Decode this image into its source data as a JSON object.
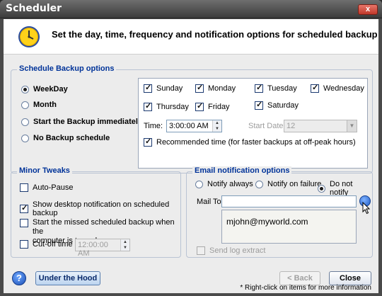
{
  "window": {
    "title": "Scheduler",
    "close_glyph": "x"
  },
  "header": {
    "heading": "Set the day, time, frequency and notification options for scheduled backup",
    "icon": "clock-icon"
  },
  "schedule": {
    "legend": "Schedule Backup options",
    "modes": [
      {
        "label": "WeekDay",
        "selected": true
      },
      {
        "label": "Month",
        "selected": false
      },
      {
        "label": "Start the Backup immediately",
        "selected": false
      },
      {
        "label": "No Backup schedule",
        "selected": false
      }
    ],
    "days": [
      {
        "label": "Sunday",
        "checked": true
      },
      {
        "label": "Monday",
        "checked": true
      },
      {
        "label": "Tuesday",
        "checked": true
      },
      {
        "label": "Wednesday",
        "checked": true
      },
      {
        "label": "Thursday",
        "checked": true
      },
      {
        "label": "Friday",
        "checked": true
      },
      {
        "label": "Saturday",
        "checked": true
      }
    ],
    "time_label": "Time:",
    "time_value": "3:00:00 AM",
    "start_date_label": "Start Date:",
    "start_date_value": "12",
    "recommended_label": "Recommended time (for faster backups at off-peak hours)"
  },
  "tweaks": {
    "legend": "Minor Tweaks",
    "auto_pause": "Auto-Pause",
    "show_notification": "Show desktop notification on scheduled backup",
    "start_missed_line1": "Start the missed scheduled backup when the",
    "start_missed_line2": "computer is turned on",
    "cutoff_label": "Cut-off time",
    "cutoff_value": "12:00:00 AM"
  },
  "email": {
    "legend": "Email notification options",
    "notify_options": [
      {
        "label": "Notify always",
        "selected": false
      },
      {
        "label": "Notify on failure",
        "selected": false
      },
      {
        "label": "Do not notify",
        "selected": true
      }
    ],
    "mail_to_label": "Mail To:",
    "mail_to_value": "",
    "recipients": [
      "mjohn@myworld.com"
    ],
    "send_log_label": "Send log extract"
  },
  "footer": {
    "help_glyph": "?",
    "under_hood_label": "Under the Hood",
    "back_label": "< Back",
    "close_label": "Close",
    "note": "* Right-click on items for more information"
  }
}
